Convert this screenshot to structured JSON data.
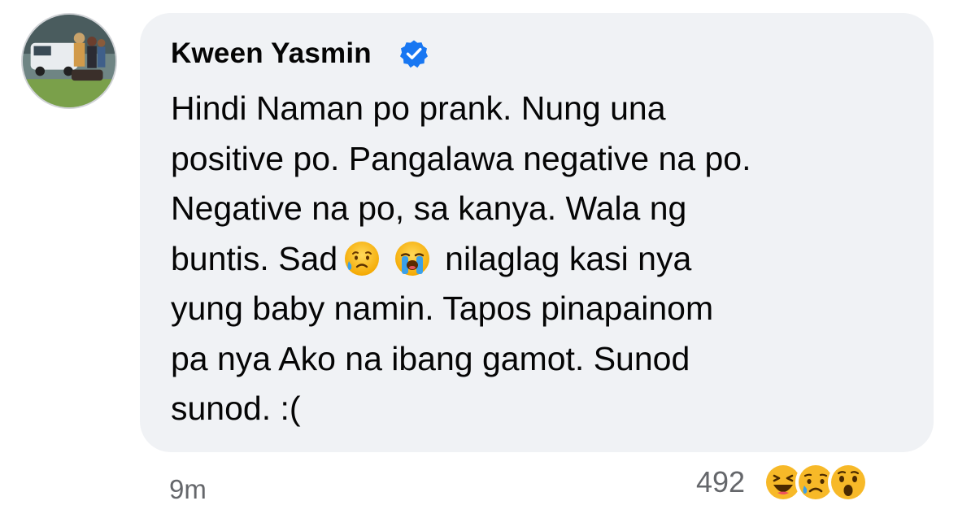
{
  "comment": {
    "author": "Kween Yasmin",
    "verified": true,
    "text_lines": [
      [
        "Hindi Naman po prank. Nung una"
      ],
      [
        "positive po. Pangalawa negative na po."
      ],
      [
        "Negative na po, sa kanya. Wala ng"
      ],
      [
        "buntis. Sad",
        "nilaglag kasi nya"
      ],
      [
        "yung baby namin. Tapos pinapainom"
      ],
      [
        "pa nya Ako na ibang gamot. Sunod"
      ],
      [
        "sunod. :("
      ]
    ],
    "inline_emojis": [
      "sad-but-relieved-face",
      "loudly-crying-face"
    ],
    "timestamp": "9m",
    "reaction_count": "492",
    "reaction_types": [
      "haha",
      "sad",
      "wow"
    ]
  },
  "icons": {
    "avatar": "profile-photo",
    "verified": "verified-badge-icon"
  },
  "colors": {
    "bubble_bg": "#f0f2f5",
    "text": "#050505",
    "meta": "#65676b",
    "verified_blue": "#1877f2"
  }
}
